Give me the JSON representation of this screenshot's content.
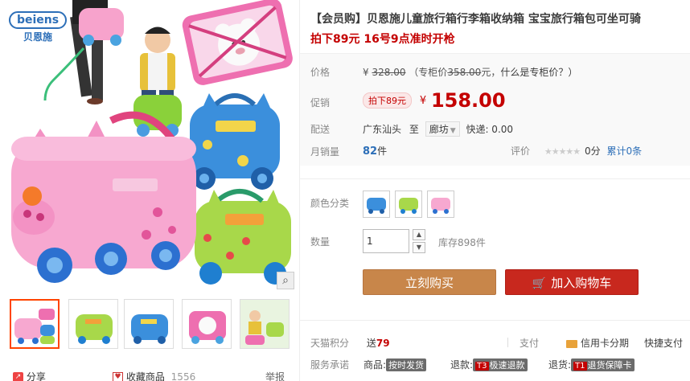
{
  "brand": {
    "logo_text": "beiens",
    "logo_cn": "贝恩施"
  },
  "gallery": {
    "zoom_icon": "magnifier-icon",
    "share_label": "分享",
    "favorite_label": "收藏商品",
    "favorite_count": "1556",
    "report_label": "举报",
    "thumbnails": [
      "pink-pig-suitcase",
      "green-suitcase",
      "blue-suitcase",
      "pink-bear-suitcase",
      "kids-riding"
    ]
  },
  "product": {
    "title": "【会员购】贝恩施儿童旅行箱行李箱收纳箱 宝宝旅行箱包可坐可骑",
    "promo_line": "拍下89元 16号9点准时开枪"
  },
  "price": {
    "label": "价格",
    "currency": "¥",
    "original": "328.00",
    "counter_prefix": "（专柜价",
    "counter_price": "358.00",
    "counter_suffix": "元，",
    "counter_hint": "什么是专柜价？）"
  },
  "promotion": {
    "label": "促销",
    "tag": "拍下89元",
    "currency": "¥",
    "price": "158.00"
  },
  "shipping": {
    "label": "配送",
    "from": "广东汕头",
    "to_word": "至",
    "to_city": "廊坊",
    "fee": "快递: 0.00"
  },
  "sales": {
    "label": "月销量",
    "count": "82",
    "unit": "件",
    "rating_label": "评价",
    "stars": "★★★★★",
    "score": "0分",
    "review_link": "累计0条"
  },
  "color": {
    "label": "颜色分类",
    "options": [
      "blue",
      "green",
      "pink"
    ]
  },
  "quantity": {
    "label": "数量",
    "value": "1",
    "stock": "库存898件"
  },
  "actions": {
    "buy_now": "立刻购买",
    "add_to_cart": "加入购物车"
  },
  "points": {
    "label": "天猫积分",
    "value_prefix": "送",
    "value": "79",
    "pay_label": "支付",
    "credit": "信用卡分期",
    "quickpay": "快捷支付"
  },
  "services": {
    "label": "服务承诺",
    "item1_prefix": "商品:",
    "item1_tag": "按时发货",
    "item2_prefix": "退款:",
    "item2_code": "T3",
    "item2_tag": "极速退款",
    "item3_prefix": "退货:",
    "item3_code": "T1",
    "item3_tag": "退货保障卡"
  },
  "colors": {
    "accent_red": "#c40000",
    "link_blue": "#2d6fb8",
    "buy_orange": "#c8864a",
    "cart_red": "#c8281e"
  }
}
